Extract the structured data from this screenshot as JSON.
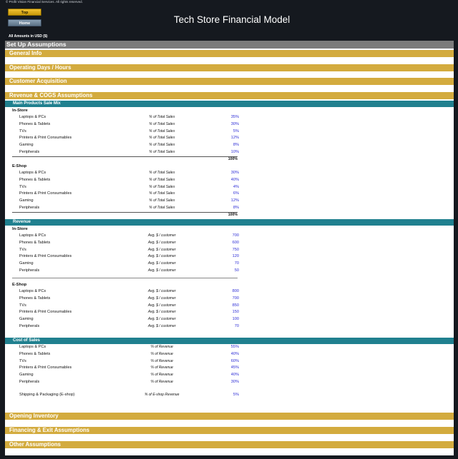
{
  "header": {
    "copyright": "© Profit Vision Financial Services. All rights reserved.",
    "top_button": "Top",
    "home_button": "Home",
    "title": "Tech Store Financial Model",
    "amounts": "All Amounts in  USD ($)"
  },
  "sections": {
    "setup": "Set Up Assumptions",
    "general": "General Info",
    "operating": "Operating Days / Hours",
    "customer": "Customer Acquisition",
    "revenue_cogs": "Revenue & COGS Assumptions",
    "opening_inventory": "Opening Inventory",
    "financing": "Financing & Exit Assumptions",
    "other": "Other Assumptions"
  },
  "sales_mix": {
    "heading": "Main Products Sale Mix",
    "instore_label": "In-Store",
    "instore": [
      {
        "label": "Laptops & PCs",
        "unit": "% of Total Sales",
        "value": "35%"
      },
      {
        "label": "Phones & Tablets",
        "unit": "% of Total Sales",
        "value": "30%"
      },
      {
        "label": "TVs",
        "unit": "% of Total Sales",
        "value": "5%"
      },
      {
        "label": "Printers & Print Consumables",
        "unit": "% of Total Sales",
        "value": "12%"
      },
      {
        "label": "Gaming",
        "unit": "% of Total Sales",
        "value": "8%"
      },
      {
        "label": "Peripherals",
        "unit": "% of Total Sales",
        "value": "10%"
      }
    ],
    "instore_total": "100%",
    "eshop_label": "E-Shop",
    "eshop": [
      {
        "label": "Laptops & PCs",
        "unit": "% of Total Sales",
        "value": "30%"
      },
      {
        "label": "Phones & Tablets",
        "unit": "% of Total Sales",
        "value": "40%"
      },
      {
        "label": "TVs",
        "unit": "% of Total Sales",
        "value": "4%"
      },
      {
        "label": "Printers & Print Consumables",
        "unit": "% of Total Sales",
        "value": "6%"
      },
      {
        "label": "Gaming",
        "unit": "% of Total Sales",
        "value": "12%"
      },
      {
        "label": "Peripherals",
        "unit": "% of Total Sales",
        "value": "8%"
      }
    ],
    "eshop_total": "100%"
  },
  "revenue": {
    "heading": "Revenue",
    "instore_label": "In-Store",
    "instore": [
      {
        "label": "Laptops & PCs",
        "unit": "Avg. $ / customer",
        "value": "700"
      },
      {
        "label": "Phones & Tablets",
        "unit": "Avg. $ / customer",
        "value": "600"
      },
      {
        "label": "TVs",
        "unit": "Avg. $ / customer",
        "value": "750"
      },
      {
        "label": "Printers & Print Consumables",
        "unit": "Avg. $ / customer",
        "value": "120"
      },
      {
        "label": "Gaming",
        "unit": "Avg. $ / customer",
        "value": "70"
      },
      {
        "label": "Peripherals",
        "unit": "Avg. $ / customer",
        "value": "50"
      }
    ],
    "eshop_label": "E-Shop",
    "eshop": [
      {
        "label": "Laptops & PCs",
        "unit": "Avg. $ / customer",
        "value": "800"
      },
      {
        "label": "Phones & Tablets",
        "unit": "Avg. $ / customer",
        "value": "700"
      },
      {
        "label": "TVs",
        "unit": "Avg. $ / customer",
        "value": "850"
      },
      {
        "label": "Printers & Print Consumables",
        "unit": "Avg. $ / customer",
        "value": "150"
      },
      {
        "label": "Gaming",
        "unit": "Avg. $ / customer",
        "value": "100"
      },
      {
        "label": "Peripherals",
        "unit": "Avg. $ / customer",
        "value": "70"
      }
    ]
  },
  "cost_of_sales": {
    "heading": "Cost of Sales",
    "rows": [
      {
        "label": "Laptops & PCs",
        "unit": "% of Revenue",
        "value": "55%"
      },
      {
        "label": "Phones & Tablets",
        "unit": "% of Revenue",
        "value": "40%"
      },
      {
        "label": "TVs",
        "unit": "% of Revenue",
        "value": "60%"
      },
      {
        "label": "Printers & Print Consumables",
        "unit": "% of Revenue",
        "value": "45%"
      },
      {
        "label": "Gaming",
        "unit": "% of Revenue",
        "value": "40%"
      },
      {
        "label": "Peripherals",
        "unit": "% of Revenue",
        "value": "30%"
      }
    ],
    "shipping": {
      "label": "Shipping & Packaging (E-shop)",
      "unit": "% of E-shop Revenue",
      "value": "5%"
    }
  },
  "colors": {
    "frame": "#15191f",
    "gold": "#d3ab3e",
    "teal": "#20808f",
    "grey": "#7b7b7b",
    "input_blue": "#2d2dd6"
  }
}
